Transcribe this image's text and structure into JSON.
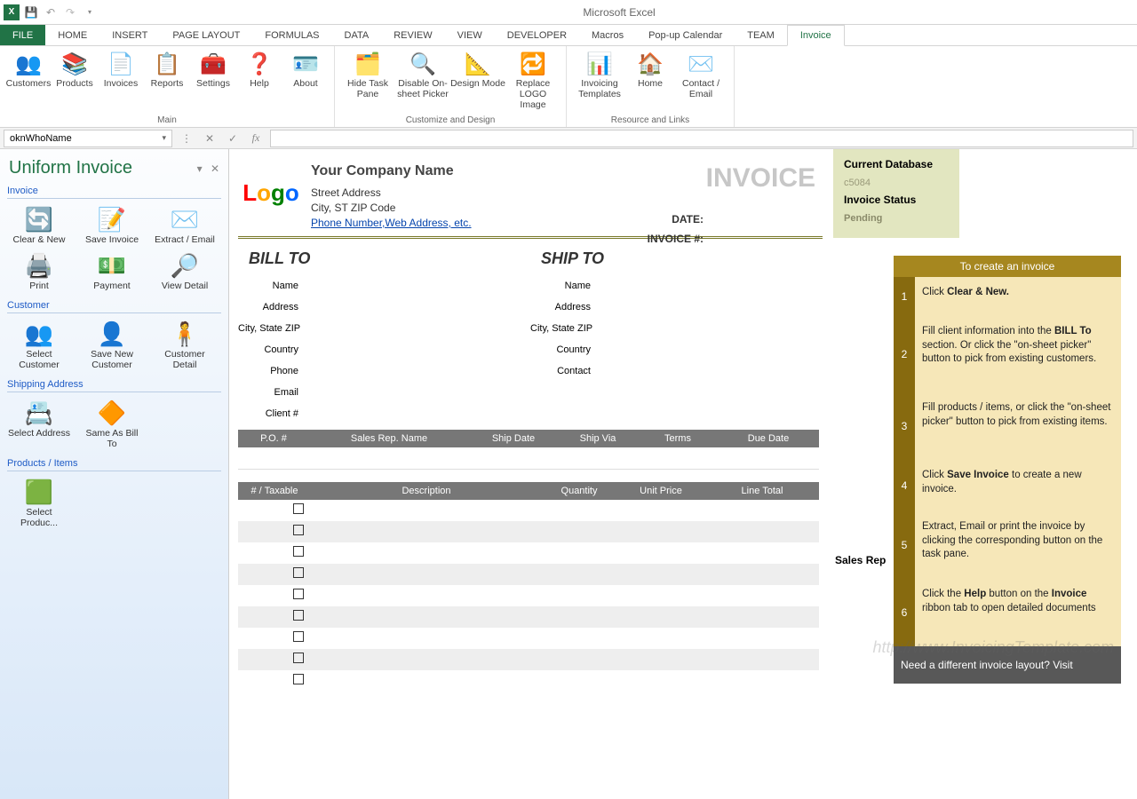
{
  "app_title": "Microsoft Excel",
  "qat": {
    "excel_icon": "X",
    "save": "💾",
    "undo": "↶",
    "redo": "↷"
  },
  "tabs": [
    "FILE",
    "HOME",
    "INSERT",
    "PAGE LAYOUT",
    "FORMULAS",
    "DATA",
    "REVIEW",
    "VIEW",
    "DEVELOPER",
    "Macros",
    "Pop-up Calendar",
    "TEAM",
    "Invoice"
  ],
  "ribbon": {
    "groups": [
      {
        "label": "Main",
        "items": [
          {
            "name": "customers",
            "label": "Customers",
            "icon": "👥"
          },
          {
            "name": "products",
            "label": "Products",
            "icon": "📚"
          },
          {
            "name": "invoices",
            "label": "Invoices",
            "icon": "📄"
          },
          {
            "name": "reports",
            "label": "Reports",
            "icon": "📋"
          },
          {
            "name": "settings",
            "label": "Settings",
            "icon": "🧰"
          },
          {
            "name": "help",
            "label": "Help",
            "icon": "❓"
          },
          {
            "name": "about",
            "label": "About",
            "icon": "🪪"
          }
        ]
      },
      {
        "label": "Customize and Design",
        "items": [
          {
            "name": "hide-task-pane",
            "label": "Hide Task Pane",
            "icon": "🗂️"
          },
          {
            "name": "disable-picker",
            "label": "Disable On-sheet Picker",
            "icon": "🔍"
          },
          {
            "name": "design-mode",
            "label": "Design Mode",
            "icon": "📐"
          },
          {
            "name": "replace-logo",
            "label": "Replace LOGO Image",
            "icon": "🔁"
          }
        ]
      },
      {
        "label": "Resource and Links",
        "items": [
          {
            "name": "invoicing-templates",
            "label": "Invoicing Templates",
            "icon": "📊"
          },
          {
            "name": "home",
            "label": "Home",
            "icon": "🏠"
          },
          {
            "name": "contact-email",
            "label": "Contact / Email",
            "icon": "✉️"
          }
        ]
      }
    ]
  },
  "formula_bar": {
    "namebox": "oknWhoName",
    "fx": "fx"
  },
  "taskpane": {
    "title": "Uniform Invoice",
    "groups": [
      {
        "title": "Invoice",
        "items": [
          {
            "name": "clear-new",
            "label": "Clear & New",
            "icon": "🔄"
          },
          {
            "name": "save-invoice",
            "label": "Save Invoice",
            "icon": "📝"
          },
          {
            "name": "extract-email",
            "label": "Extract / Email",
            "icon": "✉️"
          },
          {
            "name": "print",
            "label": "Print",
            "icon": "🖨️"
          },
          {
            "name": "payment",
            "label": "Payment",
            "icon": "💵"
          },
          {
            "name": "view-detail",
            "label": "View Detail",
            "icon": "🔎"
          }
        ]
      },
      {
        "title": "Customer",
        "items": [
          {
            "name": "select-customer",
            "label": "Select Customer",
            "icon": "👥"
          },
          {
            "name": "save-new-customer",
            "label": "Save New Customer",
            "icon": "👤"
          },
          {
            "name": "customer-detail",
            "label": "Customer Detail",
            "icon": "🧍"
          }
        ]
      },
      {
        "title": "Shipping Address",
        "items": [
          {
            "name": "select-address",
            "label": "Select Address",
            "icon": "📇"
          },
          {
            "name": "same-as-bill-to",
            "label": "Same As Bill To",
            "icon": "🔶"
          }
        ]
      },
      {
        "title": "Products / Items",
        "items": [
          {
            "name": "select-products",
            "label": "Select Produc...",
            "icon": "🟩"
          }
        ]
      }
    ]
  },
  "invoice": {
    "company": {
      "name": "Your Company Name",
      "street": "Street Address",
      "city": "City, ST  ZIP Code",
      "link": "Phone Number,Web Address, etc."
    },
    "title": "INVOICE",
    "meta_labels": {
      "date": "DATE:",
      "number": "INVOICE #:"
    },
    "bill_to": "BILL TO",
    "ship_to": "SHIP TO",
    "field_labels": [
      "Name",
      "Address",
      "City, State ZIP",
      "Country",
      "Phone",
      "Email",
      "Client #"
    ],
    "ship_labels": [
      "Name",
      "Address",
      "City, State ZIP",
      "Country",
      "Contact"
    ],
    "meta_cols": [
      "P.O. #",
      "Sales Rep. Name",
      "Ship Date",
      "Ship Via",
      "Terms",
      "Due Date"
    ],
    "item_cols": [
      "# / Taxable",
      "Description",
      "Quantity",
      "Unit Price",
      "Line Total"
    ]
  },
  "right": {
    "db_label": "Current Database",
    "db_value": "c5084",
    "status_label": "Invoice Status",
    "status_value": "Pending",
    "sales_rep": "Sales Rep",
    "help_title": "To create an invoice",
    "steps": [
      {
        "n": "1",
        "html": "Click <b>Clear & New.</b>"
      },
      {
        "n": "2",
        "html": "Fill client information into the <b>BILL To</b> section. Or click the \"on-sheet picker\" button to pick from existing customers."
      },
      {
        "n": "3",
        "html": "Fill products / items, or click the \"on-sheet picker\" button to pick from existing items."
      },
      {
        "n": "4",
        "html": "Click <b>Save Invoice</b> to create a new invoice."
      },
      {
        "n": "5",
        "html": "Extract, Email or print the invoice by clicking the corresponding button on the task pane."
      },
      {
        "n": "6",
        "html": "Click the <b>Help</b> button on the <b>Invoice</b> ribbon tab to open detailed documents"
      }
    ],
    "footer": "Need a different invoice layout? Visit",
    "watermark": "http://www.InvoicingTemplate.com"
  }
}
